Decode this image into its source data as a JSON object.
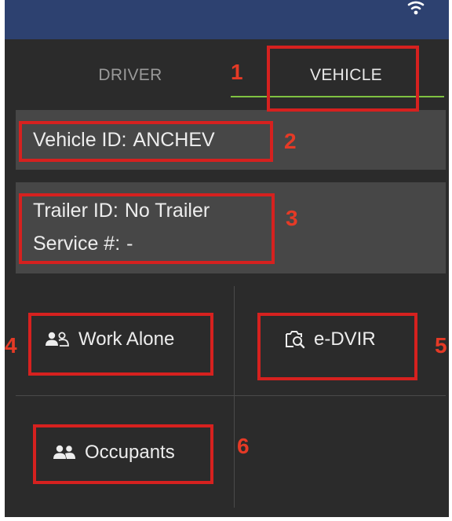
{
  "tabs": {
    "driver": "DRIVER",
    "vehicle": "VEHICLE"
  },
  "vehicle": {
    "id_label": "Vehicle ID:",
    "id_value": "ANCHEV"
  },
  "trailer": {
    "id_label": "Trailer ID:",
    "id_value": "No Trailer",
    "service_label": "Service #:",
    "service_value": "-"
  },
  "actions": {
    "work_alone": "Work Alone",
    "edvir": "e-DVIR",
    "occupants": "Occupants"
  },
  "callouts": [
    "1",
    "2",
    "3",
    "4",
    "5",
    "6"
  ],
  "colors": {
    "status_bar": "#2d4170",
    "background": "#2b2b2b",
    "card": "#474747",
    "tab_underline": "#7fc241",
    "callout": "#d6211f"
  },
  "icons": [
    "wifi-icon",
    "group-icon",
    "inspection-icon"
  ]
}
